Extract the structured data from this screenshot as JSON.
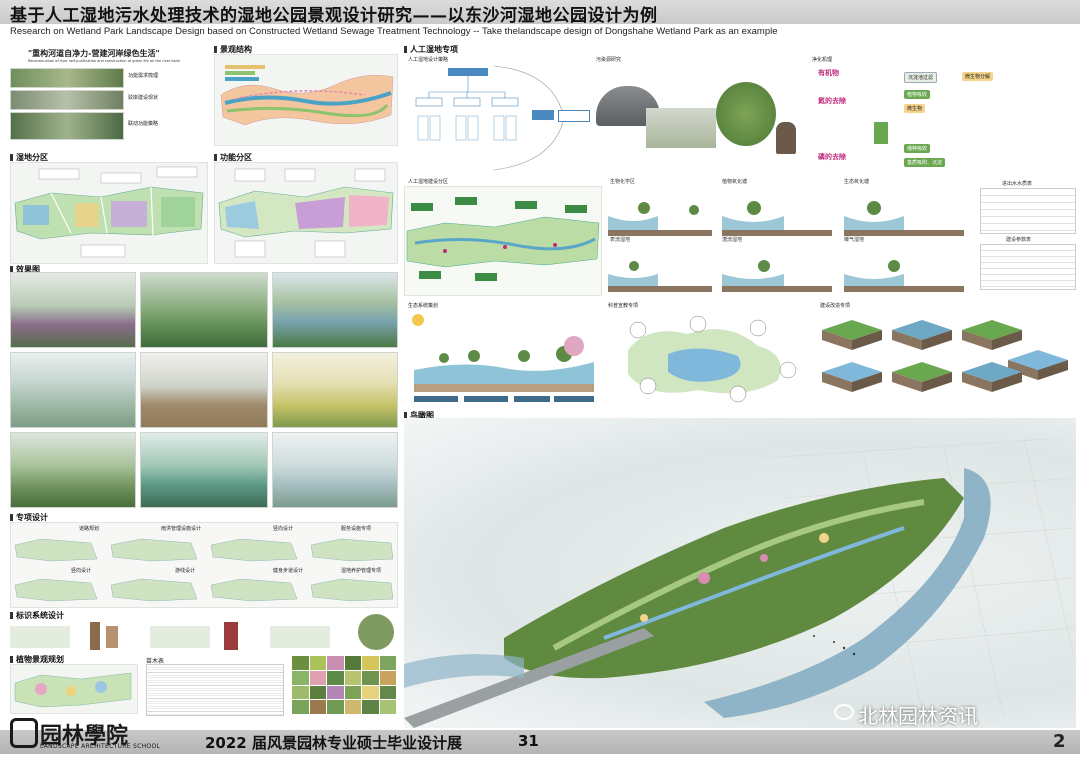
{
  "header": {
    "title": "基于人工湿地污水处理技术的湿地公园景观设计研究——以东沙河湿地公园设计为例",
    "subtitle": "Research on Wetland Park Landscape Design based on Constructed Wetland Sewage Treatment Technology -- Take thelandscape design of Dongshahe Wetland Park as an example"
  },
  "left": {
    "slogan": "\"重构河道自净力-营建河岸绿色生活\"",
    "slogan_en": "Reconstruction of river self-purification and construction of green life on the river bank",
    "concept_items": [
      "功能需求梳理",
      "驳岸建设现状",
      "联动功能策略"
    ],
    "landscape_structure": "景观结构",
    "wetland_zoning": "湿地分区",
    "function_zoning": "功能分区",
    "renderings": "效果图",
    "special_design": "专项设计",
    "special_items": [
      "道路规划",
      "雨洪管理设施设计",
      "竖向设计",
      "服务设施专项",
      "竖向设计",
      "游线设计",
      "健身步道设计",
      "湿地养护管理专项"
    ],
    "signage": "标识系统设计",
    "planting": "植物景观规划",
    "plant_table": "苗木表"
  },
  "middle": {
    "section_title": "人工湿地专项",
    "strategy": "人工湿地设计策略",
    "pollution": "污染源研究",
    "purification": "净化机理",
    "zoning": "人工湿地建设分区",
    "eco_system": "生态系统策划",
    "science": "科普宣教专项",
    "construction": "建设改造专项",
    "bird_view": "鸟瞰图",
    "flow": [
      "生物化学区",
      "植物氧化塘",
      "生态氧化塘",
      "表流湿地",
      "潜流湿地",
      "曝气湿地"
    ],
    "mechanism": [
      "有机物",
      "氮的去除",
      "磷的去除"
    ],
    "mechanism_right": [
      "沉淀池过滤",
      "微生物分解",
      "植物吸收",
      "微生物",
      "播种吸收",
      "基质吸附、沉淀"
    ],
    "water_table": "进出水水质表",
    "cost_table": "建设参数表"
  },
  "footer": {
    "school": "园林學院",
    "school_en": "LANDSCAPE ARCHITECTURE SCHOOL",
    "exhibition": "2022 届风景园林专业硕士毕业设计展",
    "exhibition_no": "31",
    "page": "2",
    "watermark": "北林园林资讯"
  },
  "colors": {
    "accent": "#c02a7a",
    "wetland_green": "#6aa84f",
    "water_blue": "#5aa6c8",
    "bar_gray": "#c8c8c8"
  }
}
